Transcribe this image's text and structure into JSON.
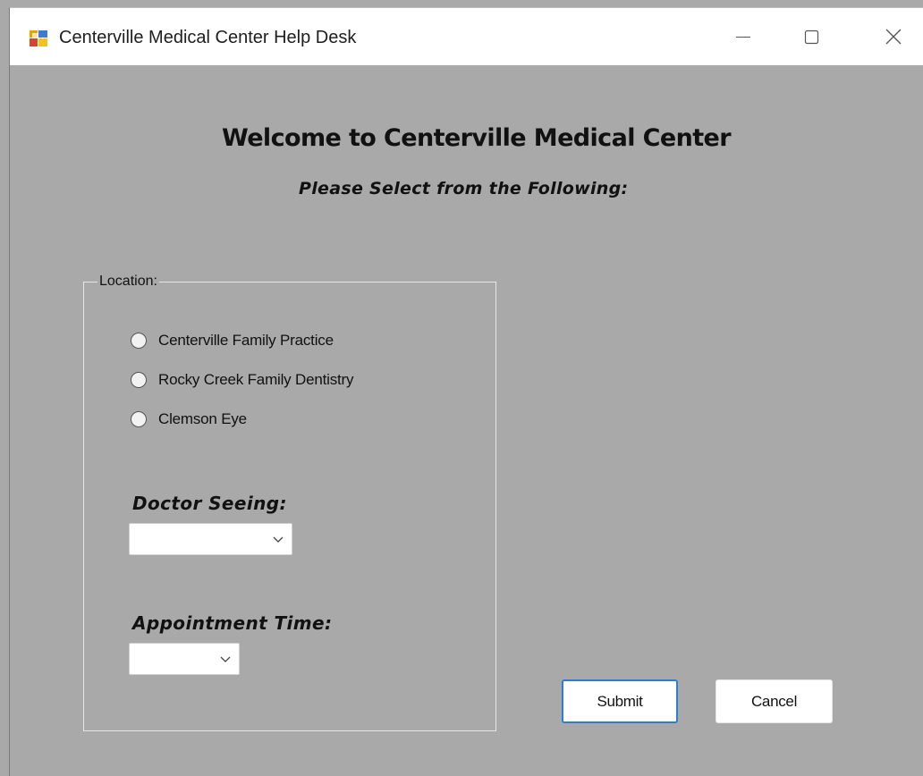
{
  "window": {
    "title": "Centerville Medical Center Help Desk",
    "app_icon": "winforms-app-icon",
    "controls": {
      "minimize_icon": "minimize-icon",
      "maximize_icon": "maximize-icon",
      "close_icon": "close-icon"
    }
  },
  "header": {
    "welcome": "Welcome to Centerville Medical Center",
    "subtitle": "Please Select from the Following:"
  },
  "location": {
    "legend": "Location:",
    "options": [
      {
        "label": "Centerville Family Practice",
        "selected": false
      },
      {
        "label": "Rocky Creek Family Dentistry",
        "selected": false
      },
      {
        "label": "Clemson Eye",
        "selected": false
      }
    ]
  },
  "doctor": {
    "label": "Doctor Seeing:",
    "value": ""
  },
  "appointment": {
    "label": "Appointment Time:",
    "value": ""
  },
  "buttons": {
    "submit": "Submit",
    "cancel": "Cancel"
  },
  "colors": {
    "background": "#a9a9a9",
    "titlebar": "#ffffff",
    "focus_border": "#2a7fd4"
  }
}
